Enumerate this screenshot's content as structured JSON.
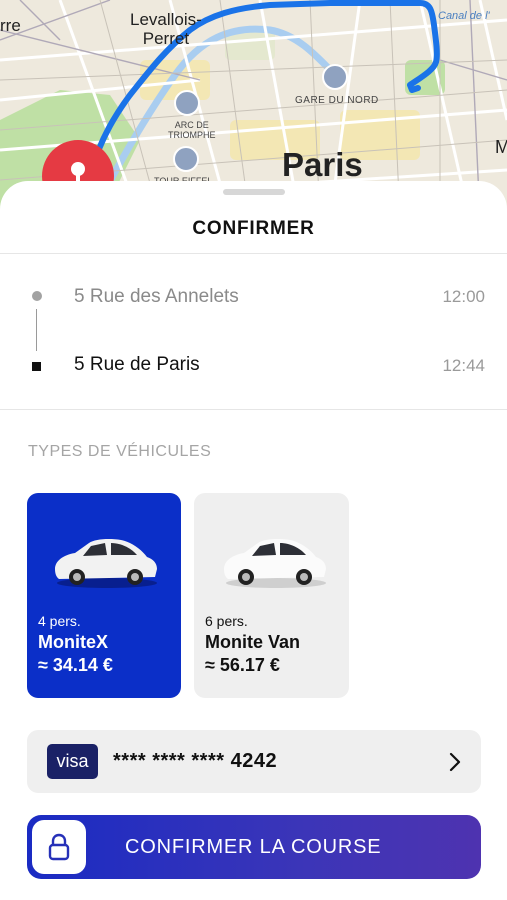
{
  "map": {
    "labels": {
      "levallois": "Levallois-\nPerret",
      "paris": "Paris",
      "gare_du_nord": "GARE DU NORD",
      "arc_de_triomphe": "ARC DE\nTRIOMPHE",
      "tour_eiffel": "TOUR EIFFEL",
      "canal": "Canal de l'",
      "partial_left": "rre",
      "partial_right": "M"
    },
    "route_color": "#1a73e8",
    "pin_color": "#e53a43"
  },
  "sheet": {
    "title": "CONFIRMER",
    "route": {
      "origin": {
        "address": "5 Rue des Annelets",
        "time": "12:00"
      },
      "destination": {
        "address": "5 Rue de Paris",
        "time": "12:44"
      }
    },
    "vehicles_title": "TYPES DE VÉHICULES",
    "vehicles": [
      {
        "capacity": "4 pers.",
        "name": "MoniteX",
        "price": "≈ 34.14 €",
        "selected": true,
        "icon": "car-icon"
      },
      {
        "capacity": "6 pers.",
        "name": "Monite Van",
        "price": "≈ 56.17 €",
        "selected": false,
        "icon": "car-icon"
      }
    ],
    "payment": {
      "brand": "visa",
      "card_number": "**** **** **** 4242",
      "icon": "chevron-right-icon"
    },
    "confirm_button": {
      "label": "CONFIRMER LA COURSE",
      "icon": "lock-icon"
    }
  },
  "colors": {
    "accent": "#0b2fc8",
    "visa_badge": "#1a2166",
    "card_background": "#efefef"
  }
}
